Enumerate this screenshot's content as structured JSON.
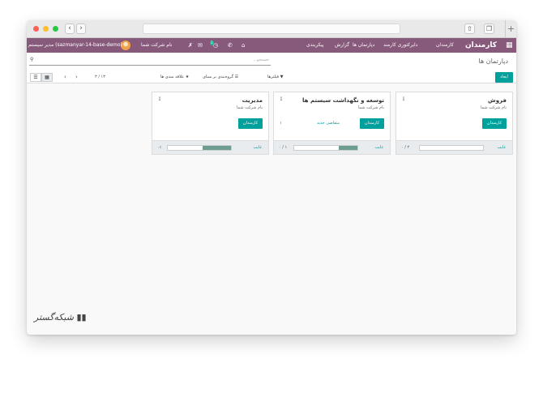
{
  "topbar": {
    "app_title": "کارمندان",
    "menu": [
      "کارمندان",
      "دایرکتوری کارمند",
      "دپارتمان ها",
      "گزارش",
      "پیکربندی"
    ],
    "user_name": "مدیر سیستم (sazmanyar-14-base-demo)",
    "company": "نام شرکت شما",
    "badge_chat": "1",
    "badge_activity": "1",
    "bg_color": "#875a7b"
  },
  "control": {
    "breadcrumb": "دپارتمان ها",
    "search_placeholder": "جستجو...",
    "create_label": "ایجاد",
    "filters_label": "فیلترها",
    "groupby_label": "گروه‌بندی بر مبنای",
    "favorites_label": "علاقه مندی ها",
    "pager": "۳ / ۱۳",
    "accent_color": "#00a09d"
  },
  "departments": [
    {
      "name": "فروش",
      "company": "نام شرکت شما",
      "button": "کارمندان",
      "absence_label": "غایب",
      "absence_value": "۰ / ۲",
      "absence_ratio": 0
    },
    {
      "name": "توسعه و نگهداشت سیستم ها",
      "company": "نام شرکت شما",
      "button": "کارمندان",
      "link": "متقاضی جدید",
      "link_count": "۱",
      "absence_label": "غایب",
      "absence_value": "۰ / ۱",
      "absence_ratio": 0.3
    },
    {
      "name": "مدیریت",
      "company": "نام شرکت شما",
      "button": "کارمندان",
      "absence_label": "غایب",
      "absence_value": "۰٪",
      "absence_ratio": 0.45
    }
  ],
  "watermark": "شبکه‌گستر"
}
